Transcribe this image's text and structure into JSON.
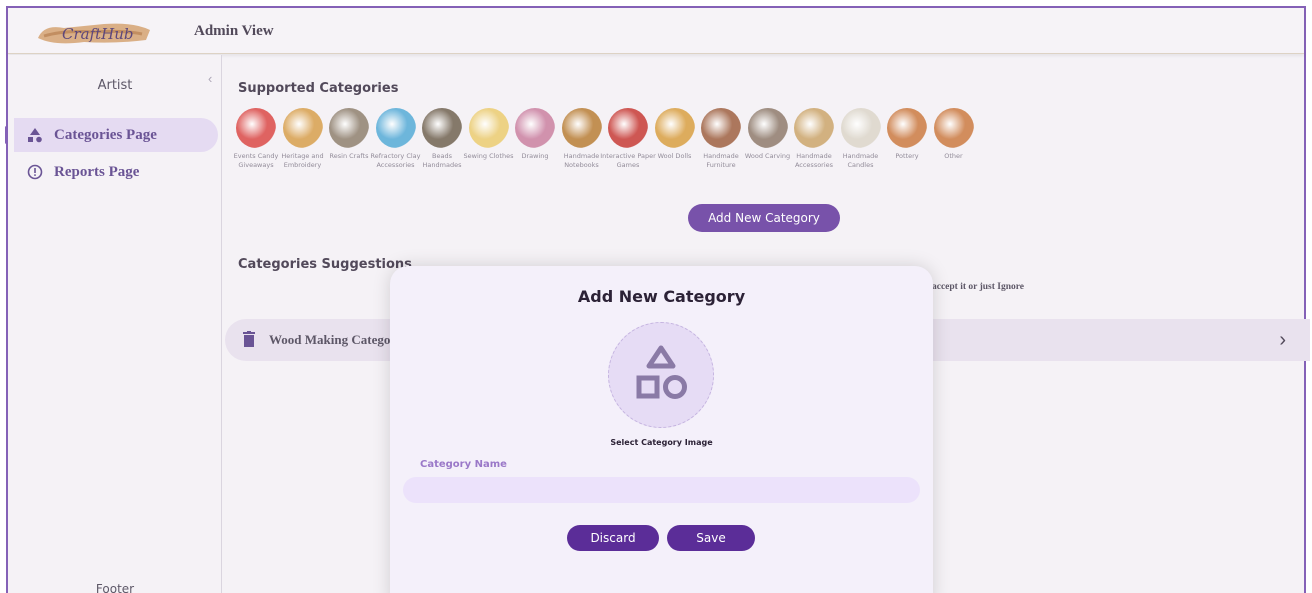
{
  "app": {
    "logo_text": "CraftHub",
    "view_title": "Admin View"
  },
  "sidebar": {
    "title": "Artist",
    "items": [
      {
        "label": "Categories Page",
        "icon": "shapes-icon",
        "active": true
      },
      {
        "label": "Reports Page",
        "icon": "alert-circle-icon",
        "active": false
      }
    ],
    "footer": "Footer"
  },
  "supported": {
    "title": "Supported Categories",
    "categories": [
      {
        "label": "Events Candy Giveaways",
        "color": "#d8413f"
      },
      {
        "label": "Heritage and Embroidery",
        "color": "#d59a45"
      },
      {
        "label": "Resin Crafts",
        "color": "#8a7a68"
      },
      {
        "label": "Refractory Clay Accessories",
        "color": "#4ea6d4"
      },
      {
        "label": "Beads Handmades",
        "color": "#6b5c4a"
      },
      {
        "label": "Sewing Clothes",
        "color": "#e9c86a"
      },
      {
        "label": "Drawing",
        "color": "#c77a9c"
      },
      {
        "label": "Handmade Notebooks",
        "color": "#b5782e"
      },
      {
        "label": "Interactive Paper Games",
        "color": "#c4332e"
      },
      {
        "label": "Wool Dolls",
        "color": "#d69a3a"
      },
      {
        "label": "Handmade Furniture",
        "color": "#9a5a3a"
      },
      {
        "label": "Wood Carving",
        "color": "#8a7566"
      },
      {
        "label": "Handmade Accessories",
        "color": "#c8a064"
      },
      {
        "label": "Handmade Candles",
        "color": "#d9d2c6"
      },
      {
        "label": "Pottery",
        "color": "#c8743a"
      },
      {
        "label": "Other",
        "color": "#c8743a"
      }
    ],
    "add_button": "Add New Category"
  },
  "suggestions": {
    "title": "Categories Suggestions",
    "hint": "accept it or just Ignore",
    "items": [
      {
        "name": "Wood Making Catego"
      }
    ]
  },
  "modal": {
    "title": "Add New Category",
    "image_caption": "Select Category Image",
    "field_label": "Category Name",
    "field_value": "",
    "discard": "Discard",
    "save": "Save"
  },
  "colors": {
    "primary": "#5b2d98",
    "accent_light": "#e0d3f0",
    "field_bg": "#ece2fb"
  }
}
